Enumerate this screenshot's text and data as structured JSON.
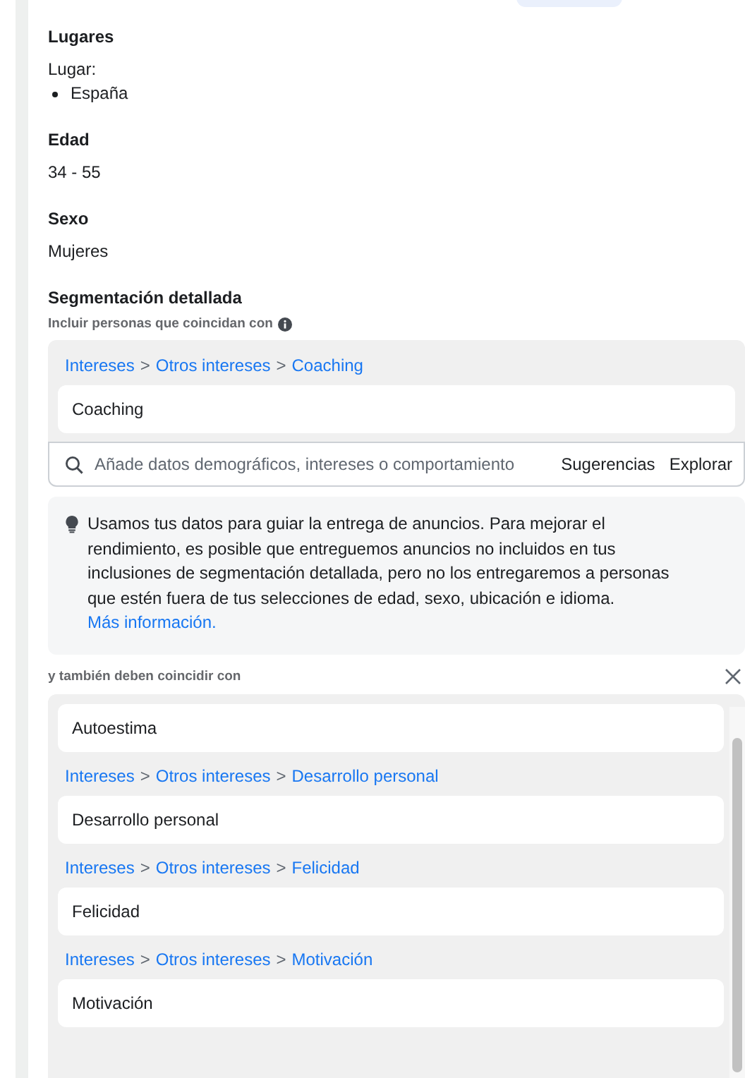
{
  "sections": [
    {
      "title": "Lugares",
      "label": "Lugar:",
      "bullets": [
        "España"
      ]
    },
    {
      "title": "Edad",
      "value": "34 - 55"
    },
    {
      "title": "Sexo",
      "value": "Mujeres"
    }
  ],
  "detailed": {
    "title": "Segmentación detallada",
    "subtitle": "Incluir personas que coincidan con",
    "include_group": [
      {
        "kind": "path",
        "parts": [
          {
            "kind": "link",
            "text": "Intereses"
          },
          {
            "kind": "sep",
            "text": ">"
          },
          {
            "kind": "link",
            "text": "Otros intereses"
          },
          {
            "kind": "sep",
            "text": ">"
          },
          {
            "kind": "link",
            "text": "Coaching"
          }
        ]
      },
      {
        "kind": "item",
        "text": "Coaching"
      }
    ],
    "search": {
      "placeholder": "Añade datos demográficos, intereses o comportamiento",
      "actions": [
        "Sugerencias",
        "Explorar"
      ]
    },
    "notice": {
      "text": "Usamos tus datos para guiar la entrega de anuncios. Para mejorar el rendimiento, es posible que entreguemos anuncios no incluidos en tus inclusiones de segmentación detallada, pero no los entregaremos a personas que estén fuera de tus selecciones de edad, sexo, ubicación e idioma.",
      "link": "Más información."
    },
    "narrow_label": "y también deben coincidir con",
    "narrow_group": [
      {
        "kind": "item",
        "text": "Autoestima"
      },
      {
        "kind": "path",
        "parts": [
          {
            "kind": "link",
            "text": "Intereses"
          },
          {
            "kind": "sep",
            "text": ">"
          },
          {
            "kind": "link",
            "text": "Otros intereses"
          },
          {
            "kind": "sep",
            "text": ">"
          },
          {
            "kind": "link",
            "text": "Desarrollo personal"
          }
        ]
      },
      {
        "kind": "item",
        "text": "Desarrollo personal"
      },
      {
        "kind": "path",
        "parts": [
          {
            "kind": "link",
            "text": "Intereses"
          },
          {
            "kind": "sep",
            "text": ">"
          },
          {
            "kind": "link",
            "text": "Otros intereses"
          },
          {
            "kind": "sep",
            "text": ">"
          },
          {
            "kind": "link",
            "text": "Felicidad"
          }
        ]
      },
      {
        "kind": "item",
        "text": "Felicidad"
      },
      {
        "kind": "path",
        "parts": [
          {
            "kind": "link",
            "text": "Intereses"
          },
          {
            "kind": "sep",
            "text": ">"
          },
          {
            "kind": "link",
            "text": "Otros intereses"
          },
          {
            "kind": "sep",
            "text": ">"
          },
          {
            "kind": "link",
            "text": "Motivación"
          }
        ]
      },
      {
        "kind": "item",
        "text": "Motivación"
      }
    ]
  }
}
